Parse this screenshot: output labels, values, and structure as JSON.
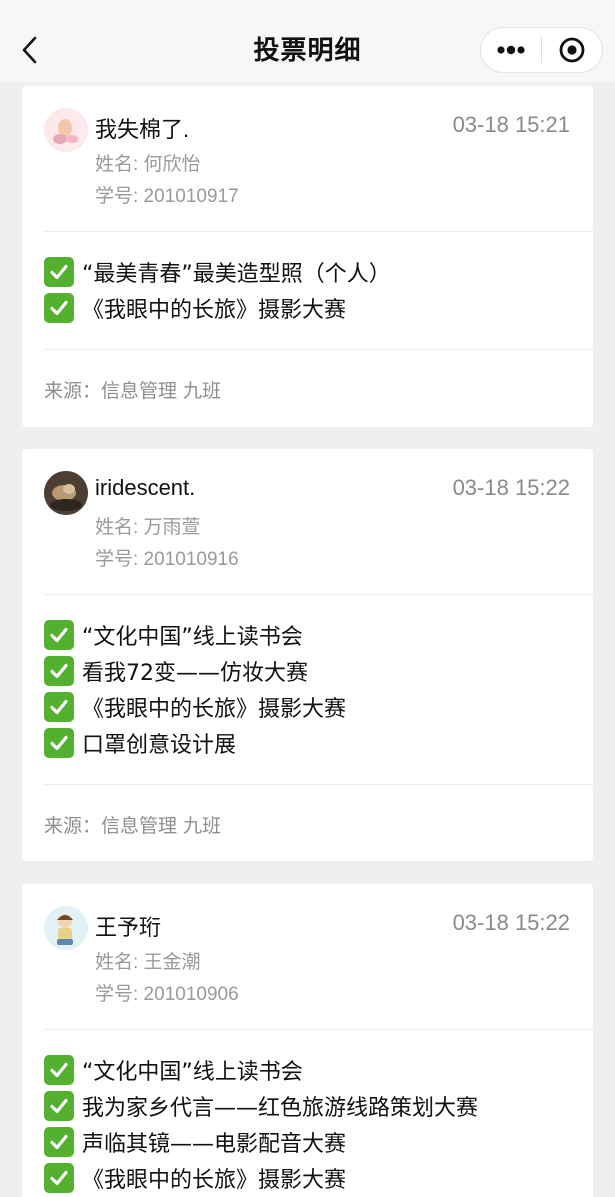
{
  "nav": {
    "title": "投票明细"
  },
  "cards": [
    {
      "nickname": "我失棉了.",
      "time": "03-18 15:21",
      "name": "姓名: 何欣怡",
      "student_id": "学号: 201010917",
      "votes": [
        "“最美青春”最美造型照（个人）",
        "《我眼中的长旅》摄影大赛"
      ],
      "source": "来源：信息管理 九班"
    },
    {
      "nickname": "iridescent.",
      "time": "03-18 15:22",
      "name": "姓名: 万雨萱",
      "student_id": "学号: 201010916",
      "votes": [
        "“文化中国”线上读书会",
        "看我72变——仿妆大赛",
        "《我眼中的长旅》摄影大赛",
        "口罩创意设计展"
      ],
      "source": "来源：信息管理 九班"
    },
    {
      "nickname": "王予珩",
      "time": "03-18 15:22",
      "name": "姓名: 王金潮",
      "student_id": "学号: 201010906",
      "votes": [
        "“文化中国”线上读书会",
        "我为家乡代言——红色旅游线路策划大赛",
        "声临其镜——电影配音大赛",
        "《我眼中的长旅》摄影大赛"
      ]
    }
  ]
}
